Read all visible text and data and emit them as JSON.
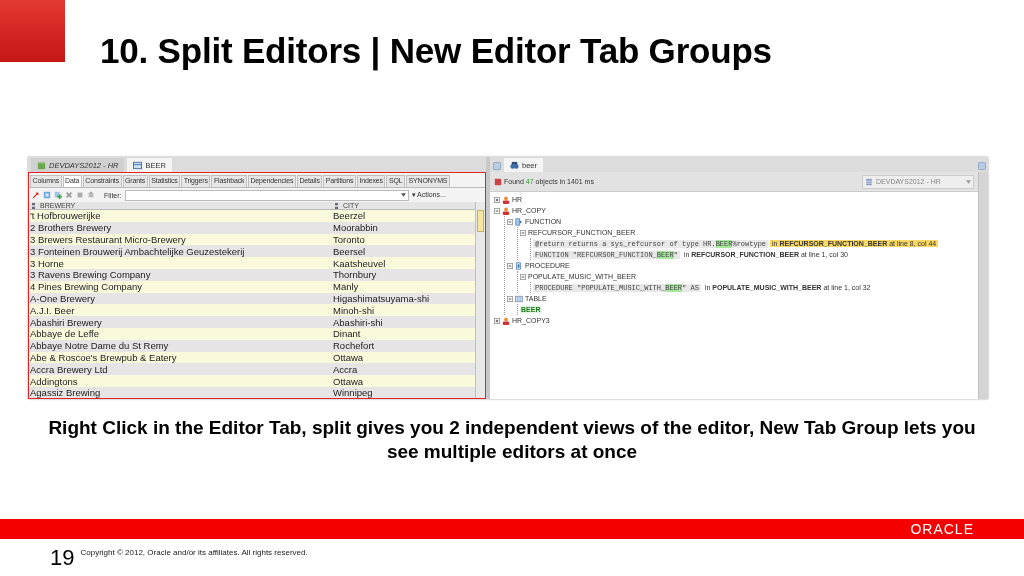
{
  "slide": {
    "title": "10. Split Editors | New Editor Tab Groups",
    "caption": "Right Click in the Editor Tab, split gives you 2 independent views of the editor, New Tab Group lets you see multiple editors at once",
    "logo": "ORACLE",
    "page_number": "19",
    "copyright": "Copyright © 2012, Oracle and/or its affiliates. All rights reserved."
  },
  "left_editor": {
    "tabs": [
      {
        "label": "DEVDAYS2012 - HR",
        "kind": "connection",
        "selected": false
      },
      {
        "label": "BEER",
        "kind": "table",
        "selected": true
      }
    ],
    "subtabs": [
      {
        "label": "Columns",
        "selected": false
      },
      {
        "label": "Data",
        "selected": true
      },
      {
        "label": "Constraints",
        "selected": false
      },
      {
        "label": "Grants",
        "selected": false
      },
      {
        "label": "Statistics",
        "selected": false
      },
      {
        "label": "Triggers",
        "selected": false
      },
      {
        "label": "Flashback",
        "selected": false
      },
      {
        "label": "Dependencies",
        "selected": false
      },
      {
        "label": "Details",
        "selected": false
      },
      {
        "label": "Partitions",
        "selected": false
      },
      {
        "label": "Indexes",
        "selected": false
      },
      {
        "label": "SQL",
        "selected": false
      },
      {
        "label": "SYNONYMS",
        "selected": false
      }
    ],
    "filter_label": "Filter:",
    "actions": "▾ Actions...",
    "columns": [
      "BREWERY",
      "CITY"
    ],
    "rows": [
      [
        "'t Hofbrouwerijke",
        "Beerzel"
      ],
      [
        "2 Brothers Brewery",
        "Moorabbin"
      ],
      [
        "3 Brewers Restaurant Micro-Brewery",
        "Toronto"
      ],
      [
        "3 Fonteinen Brouwerij Ambachtelijke Geuzestekerij",
        "Beersel"
      ],
      [
        "3 Horne",
        "Kaatsheuvel"
      ],
      [
        "3 Ravens Brewing Company",
        "Thornbury"
      ],
      [
        "4 Pines Brewing Company",
        "Manly"
      ],
      [
        "A-One Brewery",
        "Higashimatsuyama-shi"
      ],
      [
        "A.J.I. Beer",
        "Minoh-shi"
      ],
      [
        "Abashiri Brewery",
        "Abashiri-shi"
      ],
      [
        "Abbaye de Leffe",
        "Dinant"
      ],
      [
        "Abbaye Notre Dame du St Remy",
        "Rochefort"
      ],
      [
        "Abe & Roscoe's Brewpub & Eatery",
        "Ottawa"
      ],
      [
        "Accra Brewery Ltd",
        "Accra"
      ],
      [
        "Addingtons",
        "Ottawa"
      ],
      [
        "Agassiz Brewing",
        "Winnipeg"
      ]
    ]
  },
  "right_editor": {
    "tabs": [
      {
        "label": "beer",
        "kind": "search",
        "selected": true
      }
    ],
    "status_pre": "Found",
    "status_count": "47",
    "status_post": "objects in 1401 ms",
    "connection": "DEVDAYS2012 - HR",
    "tree": [
      {
        "kind": "schema",
        "label": "HR",
        "expanded": false
      },
      {
        "kind": "schema",
        "label": "HR_COPY",
        "expanded": true,
        "children": [
          {
            "kind": "function",
            "label": "FUNCTION",
            "expanded": true,
            "children": [
              {
                "kind": "object",
                "label": "REFCURSOR_FUNCTION_BEER",
                "expanded": true,
                "children": [
                  {
                    "kind": "match",
                    "selected": true,
                    "code_pre": "@return returns a sys_refcursor of type HR.",
                    "code_match": "BEER",
                    "code_post": "%rowtype",
                    "where": "in **REFCURSOR_FUNCTION_BEER** at line 8, col 44"
                  },
                  {
                    "kind": "match",
                    "selected": false,
                    "code_pre": "FUNCTION \"REFCURSOR_FUNCTION_",
                    "code_match": "BEER",
                    "code_post": "\"",
                    "where": "in **REFCURSOR_FUNCTION_BEER** at line 1, col 30"
                  }
                ]
              }
            ]
          },
          {
            "kind": "procedure",
            "label": "PROCEDURE",
            "expanded": true,
            "children": [
              {
                "kind": "object",
                "label": "POPULATE_MUSIC_WITH_BEER",
                "expanded": true,
                "children": [
                  {
                    "kind": "match",
                    "selected": false,
                    "code_pre": "PROCEDURE \"POPULATE_MUSIC_WITH_",
                    "code_match": "BEER",
                    "code_post": "\" AS",
                    "where": "in **POPULATE_MUSIC_WITH_BEER** at line 1, col 32"
                  }
                ]
              }
            ]
          },
          {
            "kind": "table",
            "label": "TABLE",
            "expanded": true,
            "children": [
              {
                "kind": "hit",
                "label": "BEER"
              }
            ]
          }
        ]
      },
      {
        "kind": "schema",
        "label": "HR_COPY3",
        "expanded": false
      }
    ]
  }
}
